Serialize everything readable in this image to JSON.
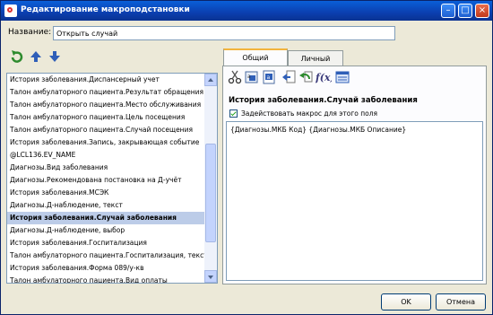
{
  "window": {
    "title": "Редактирование макроподстановки"
  },
  "name_field": {
    "label": "Название:",
    "value": "Открыть случай"
  },
  "list": {
    "items": [
      "История заболевания.Диспансерный учет",
      "Талон амбулаторного пациента.Результат обращения",
      "Талон амбулаторного пациента.Место обслуживания",
      "Талон амбулаторного пациента.Цель посещения",
      "Талон амбулаторного пациента.Случай посещения",
      "История заболевания.Запись, закрывающая событие",
      "@LCL136.EV_NAME",
      "Диагнозы.Вид заболевания",
      "Диагнозы.Рекомендована постановка на Д-учёт",
      "История заболевания.МСЭК",
      "Диагнозы.Д-наблюдение, текст",
      "История заболевания.Случай заболевания",
      "Диагнозы.Д-наблюдение, выбор",
      "История заболевания.Госпитализация",
      "Талон амбулаторного пациента.Госпитализация, текст",
      "История заболевания.Форма 089/у-кв",
      "Талон амбулаторного пациента.Вид оплаты"
    ],
    "selected_index": 11
  },
  "tabs": {
    "general": "Общий",
    "personal": "Личный",
    "active": "general"
  },
  "panel": {
    "field_title": "История заболевания.Случай заболевания",
    "checkbox_label": "Задействовать макрос для этого поля",
    "checkbox_checked": true,
    "editor_text": "{Диагнозы.МКБ Код} {Диагнозы.МКБ Описание}"
  },
  "buttons": {
    "ok": "OK",
    "cancel": "Отмена"
  },
  "icons": {
    "left_toolbar": [
      "refresh-arrow-icon",
      "arrow-up-icon",
      "arrow-down-icon"
    ],
    "panel_toolbar": [
      "scissors-icon",
      "text-field-icon",
      "page-field-icon",
      "paste-icon",
      "undo-icon",
      "function-icon",
      "form-icon"
    ]
  },
  "colors": {
    "titlebar": "#0b3fb0",
    "selection": "#bccce8",
    "tab_accent": "#f2b33d"
  }
}
